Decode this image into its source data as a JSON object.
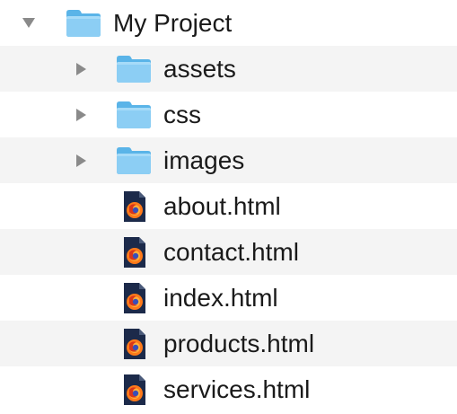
{
  "tree": {
    "root": {
      "label": "My Project",
      "icon": "folder-icon",
      "expanded": true,
      "accent": "#5ab4e8"
    },
    "folders": [
      {
        "label": "assets",
        "icon": "folder-icon",
        "expanded": false
      },
      {
        "label": "css",
        "icon": "folder-icon",
        "expanded": false
      },
      {
        "label": "images",
        "icon": "folder-icon",
        "expanded": false
      }
    ],
    "files": [
      {
        "label": "about.html",
        "icon": "firefox-html-file-icon"
      },
      {
        "label": "contact.html",
        "icon": "firefox-html-file-icon"
      },
      {
        "label": "index.html",
        "icon": "firefox-html-file-icon"
      },
      {
        "label": "products.html",
        "icon": "firefox-html-file-icon"
      },
      {
        "label": "services.html",
        "icon": "firefox-html-file-icon"
      }
    ]
  },
  "colors": {
    "stripe": "#f4f4f4",
    "folder_body": "#7cc7f2",
    "folder_tab": "#5ab4e8",
    "disclosure": "#8a8a8a",
    "file_dark": "#1c2a4a",
    "firefox_orange": "#ff7a1a"
  }
}
